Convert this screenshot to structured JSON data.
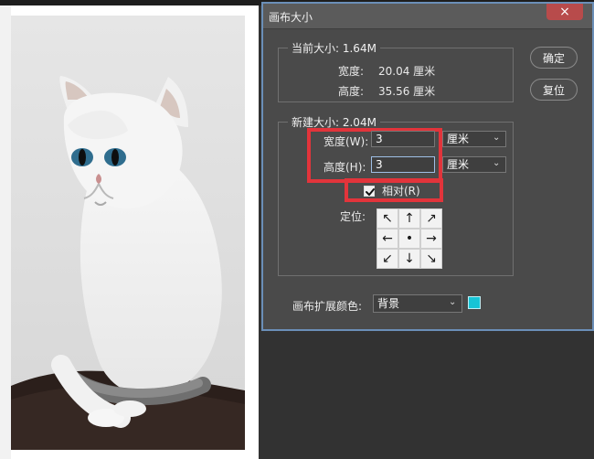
{
  "dialog": {
    "title": "画布大小",
    "close_label": "×",
    "buttons": {
      "ok": "确定",
      "reset": "复位"
    },
    "current_size": {
      "legend": "当前大小: 1.64M",
      "width_label": "宽度:",
      "width_value": "20.04 厘米",
      "height_label": "高度:",
      "height_value": "35.56 厘米"
    },
    "new_size": {
      "legend": "新建大小: 2.04M",
      "width_label": "宽度(W):",
      "width_value": "3",
      "width_unit": "厘米",
      "height_label": "高度(H):",
      "height_value": "3",
      "height_unit": "厘米",
      "relative_label": "相对(R)",
      "relative_checked": true,
      "anchor_label": "定位:"
    },
    "canvas_extension": {
      "label": "画布扩展颜色:",
      "value": "背景",
      "swatch_color": "#17c4d6"
    }
  },
  "icons": {
    "close": "close-icon",
    "checkbox": "checkbox-icon",
    "select_chevron": "chevron-down-icon",
    "anchor": [
      "arrow-up-left-icon",
      "arrow-up-icon",
      "arrow-up-right-icon",
      "arrow-left-icon",
      "anchor-center-dot-icon",
      "arrow-right-icon",
      "arrow-down-left-icon",
      "arrow-down-icon",
      "arrow-down-right-icon"
    ]
  },
  "annotation": {
    "highlight_color": "#e2343b"
  }
}
